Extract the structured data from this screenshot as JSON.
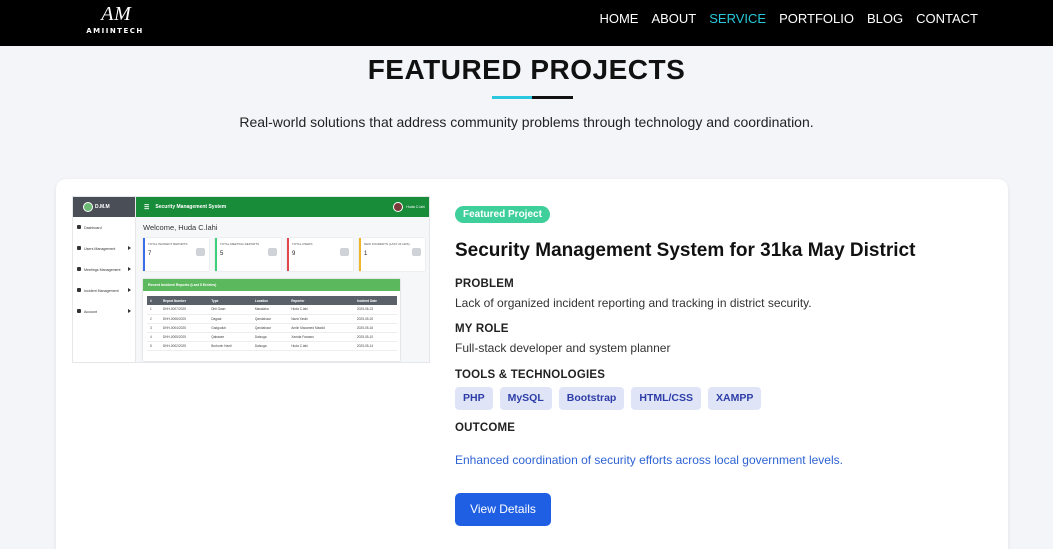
{
  "header": {
    "logo_mark": "A M",
    "logo_text": "AMIINTECH",
    "nav": [
      {
        "label": "HOME",
        "active": false
      },
      {
        "label": "ABOUT",
        "active": false
      },
      {
        "label": "SERVICE",
        "active": true
      },
      {
        "label": "PORTFOLIO",
        "active": false
      },
      {
        "label": "BLOG",
        "active": false
      },
      {
        "label": "CONTACT",
        "active": false
      }
    ]
  },
  "section": {
    "title": "FEATURED PROJECTS",
    "subtitle": "Real-world solutions that address community problems through technology and coordination."
  },
  "project": {
    "badge": "Featured Project",
    "title": "Security Management System for 31ka May District",
    "problem_label": "PROBLEM",
    "problem_text": "Lack of organized incident reporting and tracking in district security.",
    "role_label": "MY ROLE",
    "role_text": "Full-stack developer and system planner",
    "tools_label": "TOOLS & TECHNOLOGIES",
    "tools": [
      "PHP",
      "MySQL",
      "Bootstrap",
      "HTML/CSS",
      "XAMPP"
    ],
    "outcome_label": "OUTCOME",
    "outcome_text": "Enhanced coordination of security efforts across local government levels.",
    "button_label": "View Details"
  },
  "screenshot": {
    "brand": "D.M.M",
    "app_title": "Security Management System",
    "user": "Huda C.lahi",
    "welcome": "Welcome, Huda C.lahi",
    "menu": [
      "Dashboard",
      "Users Management",
      "Meetings Management",
      "Incident Management",
      "Account"
    ],
    "tiles": [
      {
        "label": "TOTAL INCIDENT REPORTS",
        "value": "7",
        "color": "#3a6ee8"
      },
      {
        "label": "TOTAL MEETING REPORTS",
        "value": "5",
        "color": "#3ecf7a"
      },
      {
        "label": "TOTAL USERS",
        "value": "9",
        "color": "#e0484e"
      },
      {
        "label": "NEW INCIDENTS (LAST 24 HRS)",
        "value": "1",
        "color": "#f0b429"
      }
    ],
    "table_title": "Recent Incident Reports (Last 5 Entries)",
    "table_headers": [
      "#",
      "Report Number",
      "Type",
      "Location",
      "Reporter",
      "Incident Date"
    ],
    "table_rows": [
      [
        "1",
        "DHH-0007/2025",
        "Dhil Gaan",
        "Masalaha",
        "Huda C.lahi",
        "2025-06-23"
      ],
      [
        "2",
        "DHH-0006/2025",
        "Dagaal",
        "Qandahaar",
        "Naza Yasiin",
        "2025-05-20"
      ],
      [
        "3",
        "DHH-0004/2025",
        "Gadgudub",
        "Qandahaar",
        "Amiin Maxamed Mawlid",
        "2025-05-16"
      ],
      [
        "4",
        "DHH-0005/2025",
        "Qabaaxe",
        "Dalsuga",
        "Xamda Faraaxo",
        "2025-05-10"
      ],
      [
        "5",
        "DHH-0002/2025",
        "Burburin Hanti",
        "Dalsuga",
        "Huda C.lahi",
        "2025-05-14"
      ]
    ]
  }
}
